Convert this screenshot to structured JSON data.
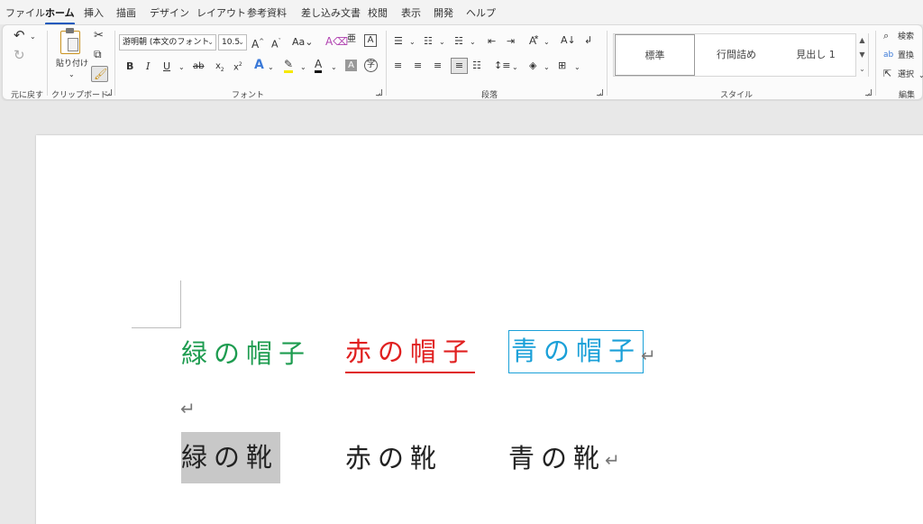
{
  "menu": {
    "tabs": [
      {
        "label": "ファイル",
        "active": false
      },
      {
        "label": "ホーム",
        "active": true
      },
      {
        "label": "挿入",
        "active": false
      },
      {
        "label": "描画",
        "active": false
      },
      {
        "label": "デザイン",
        "active": false
      },
      {
        "label": "レイアウト",
        "active": false
      },
      {
        "label": "参考資料",
        "active": false
      },
      {
        "label": "差し込み文書",
        "active": false
      },
      {
        "label": "校閲",
        "active": false
      },
      {
        "label": "表示",
        "active": false
      },
      {
        "label": "開発",
        "active": false
      },
      {
        "label": "ヘルプ",
        "active": false
      }
    ]
  },
  "ribbon": {
    "groups": {
      "undo": "元に戻す",
      "clipboard": "クリップボード",
      "font": "フォント",
      "paragraph": "段落",
      "styles": "スタイル",
      "editing": "編集"
    },
    "paste_label": "貼り付け",
    "font_name": "游明朝 (本文のフォント",
    "font_size": "10.5",
    "styles": [
      "標準",
      "行間詰め",
      "見出し 1"
    ],
    "editing": {
      "find": "検索",
      "replace": "置換",
      "select": "選択"
    }
  },
  "document": {
    "line1": [
      {
        "text": "緑の帽子",
        "color": "#1e9c50",
        "style": "plain"
      },
      {
        "text": "赤の帽子",
        "color": "#e02020",
        "style": "underline"
      },
      {
        "text": "青の帽子",
        "color": "#1aa0d8",
        "style": "boxed"
      }
    ],
    "line3": [
      {
        "text": "緑の靴",
        "color": "#222222",
        "style": "selected"
      },
      {
        "text": "赤の靴",
        "color": "#222222",
        "style": "plain"
      },
      {
        "text": "青の靴",
        "color": "#222222",
        "style": "plain"
      }
    ],
    "paragraph_mark": "↵"
  }
}
